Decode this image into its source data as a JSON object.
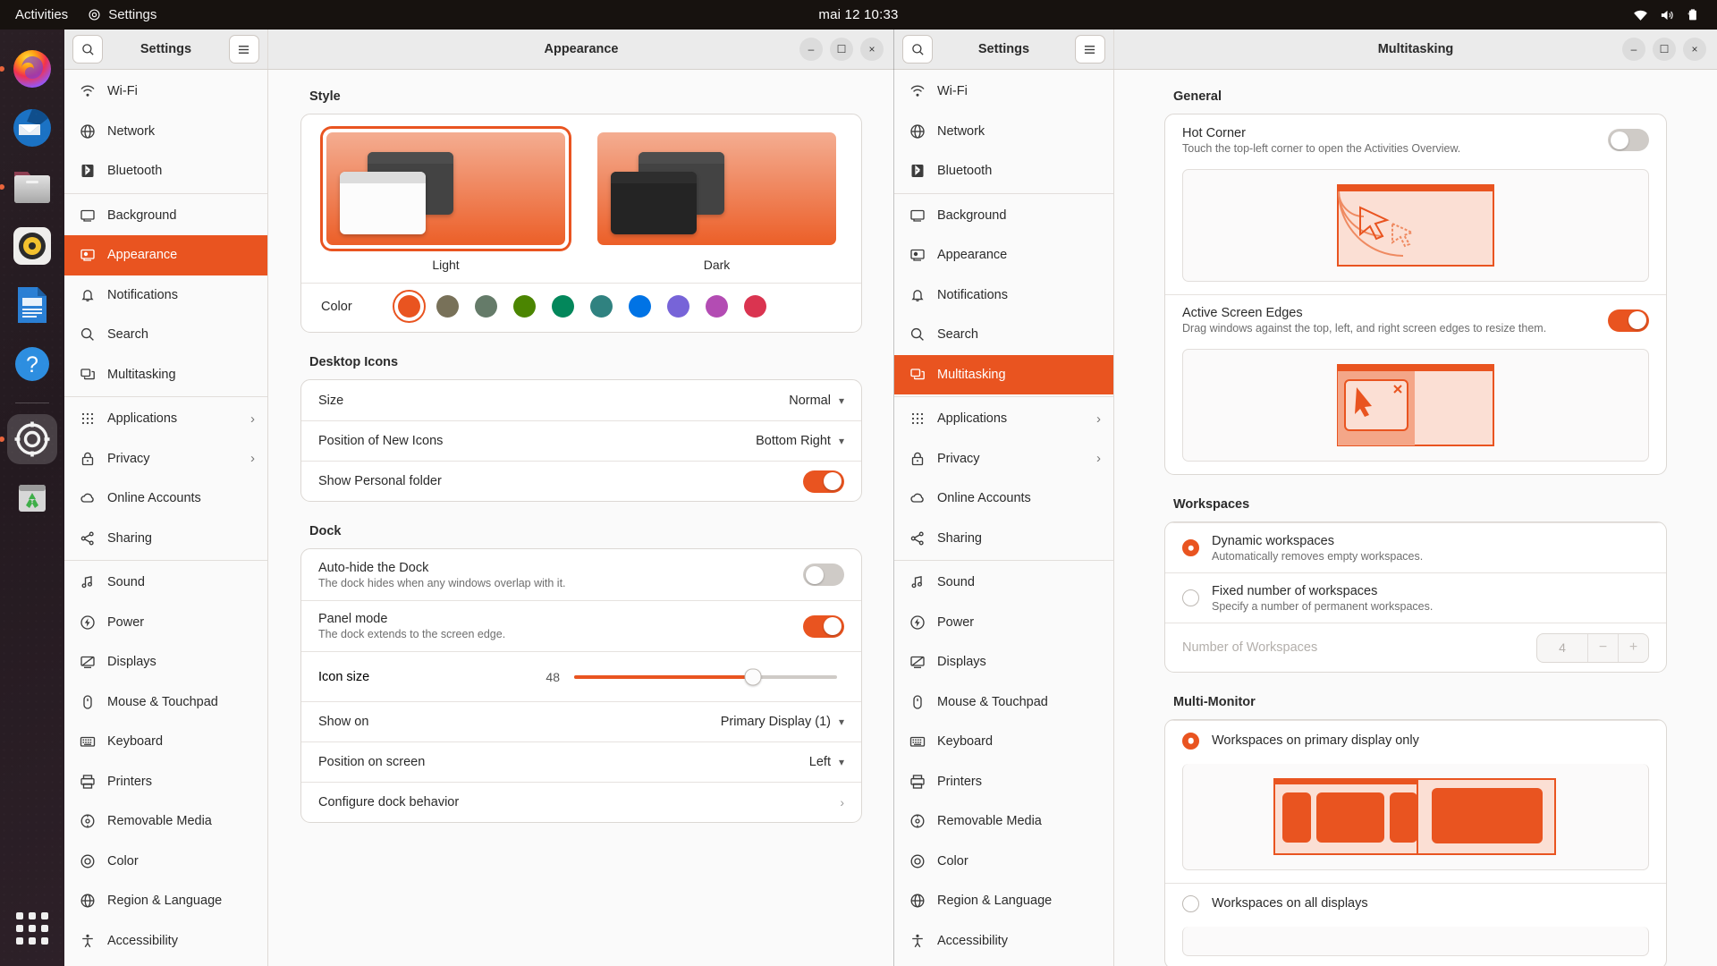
{
  "topbar": {
    "activities": "Activities",
    "app_menu": "Settings",
    "clock": "mai 12  10:33",
    "tray": [
      "wifi-icon",
      "volume-icon",
      "battery-charging-icon"
    ]
  },
  "dock": {
    "items": [
      {
        "name": "firefox",
        "running": false
      },
      {
        "name": "thunderbird",
        "running": false
      },
      {
        "name": "files",
        "running": true
      },
      {
        "name": "rhythmbox",
        "running": false
      },
      {
        "name": "libreoffice-writer",
        "running": false
      },
      {
        "name": "help",
        "running": false
      },
      {
        "name": "settings",
        "running": true,
        "active": true
      },
      {
        "name": "trash",
        "running": false
      }
    ],
    "app_grid_label": "Show Applications"
  },
  "sidebar": {
    "header_title": "Settings",
    "search_icon": "search-icon",
    "menu_icon": "hamburger-icon",
    "items": [
      {
        "label": "Wi-Fi",
        "icon": "wifi-icon"
      },
      {
        "label": "Network",
        "icon": "network-icon"
      },
      {
        "label": "Bluetooth",
        "icon": "bluetooth-icon"
      },
      {
        "label": "Background",
        "icon": "background-icon",
        "divider_before": true
      },
      {
        "label": "Appearance",
        "icon": "appearance-icon"
      },
      {
        "label": "Notifications",
        "icon": "bell-icon"
      },
      {
        "label": "Search",
        "icon": "search-icon"
      },
      {
        "label": "Multitasking",
        "icon": "multitasking-icon"
      },
      {
        "label": "Applications",
        "icon": "applications-icon",
        "chevron": "›",
        "divider_before": true
      },
      {
        "label": "Privacy",
        "icon": "lock-icon",
        "chevron": "›"
      },
      {
        "label": "Online Accounts",
        "icon": "cloud-icon"
      },
      {
        "label": "Sharing",
        "icon": "share-icon"
      },
      {
        "label": "Sound",
        "icon": "sound-icon",
        "divider_before": true
      },
      {
        "label": "Power",
        "icon": "power-icon"
      },
      {
        "label": "Displays",
        "icon": "displays-icon"
      },
      {
        "label": "Mouse & Touchpad",
        "icon": "mouse-icon"
      },
      {
        "label": "Keyboard",
        "icon": "keyboard-icon"
      },
      {
        "label": "Printers",
        "icon": "printer-icon"
      },
      {
        "label": "Removable Media",
        "icon": "removable-media-icon"
      },
      {
        "label": "Color",
        "icon": "color-icon"
      },
      {
        "label": "Region & Language",
        "icon": "region-icon"
      },
      {
        "label": "Accessibility",
        "icon": "accessibility-icon"
      }
    ]
  },
  "window_appearance": {
    "title": "Appearance",
    "selected_sidebar_index": 4,
    "buttons": {
      "minimize": "–",
      "maximize": "☐",
      "close": "×"
    },
    "style": {
      "section_title": "Style",
      "options": [
        {
          "label": "Light",
          "selected": true
        },
        {
          "label": "Dark",
          "selected": false
        }
      ],
      "color_label": "Color",
      "colors": [
        {
          "name": "orange",
          "hex": "#e95420",
          "selected": true
        },
        {
          "name": "bark",
          "hex": "#787159",
          "selected": false
        },
        {
          "name": "sage",
          "hex": "#657b69",
          "selected": false
        },
        {
          "name": "olive",
          "hex": "#4b8501",
          "selected": false
        },
        {
          "name": "viridian",
          "hex": "#03875b",
          "selected": false
        },
        {
          "name": "prussian-green",
          "hex": "#308280",
          "selected": false
        },
        {
          "name": "blue",
          "hex": "#0073e5",
          "selected": false
        },
        {
          "name": "purple",
          "hex": "#7764d8",
          "selected": false
        },
        {
          "name": "magenta",
          "hex": "#b34cb3",
          "selected": false
        },
        {
          "name": "red",
          "hex": "#da3450",
          "selected": false
        }
      ]
    },
    "desktop_icons": {
      "section_title": "Desktop Icons",
      "rows": [
        {
          "label": "Size",
          "value": "Normal",
          "control": "dropdown"
        },
        {
          "label": "Position of New Icons",
          "value": "Bottom Right",
          "control": "dropdown"
        },
        {
          "label": "Show Personal folder",
          "control": "switch",
          "state": "on"
        }
      ]
    },
    "dock": {
      "section_title": "Dock",
      "auto_hide": {
        "title": "Auto-hide the Dock",
        "subtitle": "The dock hides when any windows overlap with it.",
        "state": "off"
      },
      "panel_mode": {
        "title": "Panel mode",
        "subtitle": "The dock extends to the screen edge.",
        "state": "on"
      },
      "icon_size": {
        "label": "Icon size",
        "value": "48",
        "percent": 68
      },
      "show_on": {
        "label": "Show on",
        "value": "Primary Display (1)"
      },
      "position": {
        "label": "Position on screen",
        "value": "Left"
      },
      "configure": {
        "label": "Configure dock behavior",
        "chevron": "›"
      }
    }
  },
  "window_multitasking": {
    "title": "Multitasking",
    "sidebar_header_title": "Settings",
    "selected_sidebar_index": 7,
    "buttons": {
      "minimize": "–",
      "maximize": "☐",
      "close": "×"
    },
    "general": {
      "section_title": "General",
      "hot_corner": {
        "title": "Hot Corner",
        "subtitle": "Touch the top-left corner to open the Activities Overview.",
        "state": "off"
      },
      "active_edges": {
        "title": "Active Screen Edges",
        "subtitle": "Drag windows against the top, left, and right screen edges to resize them.",
        "state": "on"
      }
    },
    "workspaces": {
      "section_title": "Workspaces",
      "options": [
        {
          "title": "Dynamic workspaces",
          "subtitle": "Automatically removes empty workspaces.",
          "selected": true
        },
        {
          "title": "Fixed number of workspaces",
          "subtitle": "Specify a number of permanent workspaces.",
          "selected": false
        }
      ],
      "number_label": "Number of Workspaces",
      "number_value": "4",
      "minus": "−",
      "plus": "+"
    },
    "multi_monitor": {
      "section_title": "Multi-Monitor",
      "options": [
        {
          "title": "Workspaces on primary display only",
          "selected": true
        },
        {
          "title": "Workspaces on all displays",
          "selected": false
        }
      ]
    }
  },
  "theme": {
    "accent": "#e95420",
    "accent_light": "#fadbcf",
    "window_bg": "#fafafa",
    "header_bg": "#ebebeb",
    "topbar_bg": "#17120f",
    "text": "#2b2b2b"
  }
}
